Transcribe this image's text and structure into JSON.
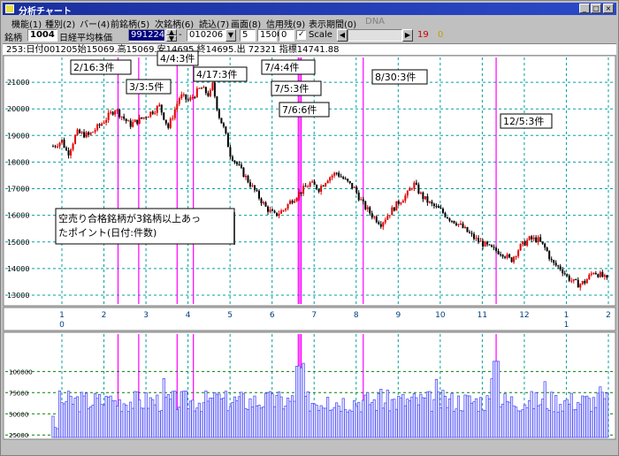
{
  "window": {
    "title": "分析チャート"
  },
  "menu": [
    "機能(1)",
    "種別(2)",
    "バー(4)",
    "前銘柄(5)",
    "次銘柄(6)",
    "読込(7)",
    "画面(8)",
    "信用残(9)",
    "表示期間(0)",
    "DNA"
  ],
  "toolbar": {
    "code_label": "銘柄",
    "code_value": "1004",
    "name_value": "日経平均株価",
    "start_date": "991224",
    "dash": "-",
    "end_date": "010206",
    "value_a": "5",
    "value_b": "1500",
    "value_c": "0",
    "scale_label": "Scale",
    "count_red": "19",
    "count_yellow": "0"
  },
  "info_line": "253:日付001205始15069.高15069.安14695.終14695.出 72321 指標14741.88",
  "chart_data": {
    "type": "line",
    "price": {
      "series_points": [
        [
          0,
          18600
        ],
        [
          6,
          18800
        ],
        [
          10,
          18300
        ],
        [
          16,
          19100
        ],
        [
          24,
          19000
        ],
        [
          32,
          19400
        ],
        [
          42,
          20000
        ],
        [
          52,
          19400
        ],
        [
          62,
          19700
        ],
        [
          72,
          20100
        ],
        [
          78,
          19300
        ],
        [
          86,
          20500
        ],
        [
          92,
          20300
        ],
        [
          100,
          20800
        ],
        [
          106,
          20500
        ],
        [
          108,
          20900
        ],
        [
          112,
          19800
        ],
        [
          116,
          19200
        ],
        [
          120,
          18300
        ],
        [
          126,
          17800
        ],
        [
          132,
          17300
        ],
        [
          138,
          16800
        ],
        [
          144,
          16300
        ],
        [
          150,
          16000
        ],
        [
          156,
          16200
        ],
        [
          162,
          16600
        ],
        [
          168,
          16900
        ],
        [
          174,
          17200
        ],
        [
          180,
          17000
        ],
        [
          186,
          17400
        ],
        [
          192,
          17600
        ],
        [
          198,
          17300
        ],
        [
          204,
          17000
        ],
        [
          210,
          16400
        ],
        [
          216,
          16000
        ],
        [
          222,
          15700
        ],
        [
          228,
          16100
        ],
        [
          234,
          16500
        ],
        [
          240,
          16800
        ],
        [
          244,
          17200
        ],
        [
          250,
          16700
        ],
        [
          256,
          16400
        ],
        [
          262,
          16200
        ],
        [
          268,
          15900
        ],
        [
          274,
          15700
        ],
        [
          280,
          15400
        ],
        [
          286,
          15100
        ],
        [
          292,
          14900
        ],
        [
          298,
          14700
        ],
        [
          304,
          14600
        ],
        [
          310,
          14300
        ],
        [
          316,
          14800
        ],
        [
          322,
          15100
        ],
        [
          328,
          15100
        ],
        [
          334,
          14700
        ],
        [
          338,
          14200
        ],
        [
          344,
          14000
        ],
        [
          348,
          13700
        ],
        [
          352,
          13500
        ],
        [
          356,
          13400
        ],
        [
          360,
          13500
        ],
        [
          366,
          13900
        ],
        [
          372,
          13700
        ],
        [
          376,
          13500
        ]
      ],
      "ylim": [
        12800,
        21800
      ],
      "yticks": [
        13000,
        14000,
        15000,
        16000,
        17000,
        18000,
        19000,
        20000,
        21000
      ]
    },
    "volume": {
      "yticks": [
        25000,
        50000,
        75000,
        100000
      ],
      "ylim": [
        20000,
        140000
      ]
    },
    "x_month_ticks": [
      "1",
      "2",
      "3",
      "4",
      "5",
      "6",
      "7",
      "8",
      "9",
      "10",
      "11",
      "12",
      "1",
      "2"
    ],
    "x_year_ticks": [
      "0",
      "1"
    ],
    "marker_lines": [
      {
        "label": "2/16:3件",
        "x": 44
      },
      {
        "label": "3/3:5件",
        "x": 58
      },
      {
        "label": "4/4:3件",
        "x": 84
      },
      {
        "label": "4/17:3件",
        "x": 95
      },
      {
        "label": "7/4:4件",
        "x": 166
      },
      {
        "label": "7/5:3件",
        "x": 167
      },
      {
        "label": "7/6:6件",
        "x": 168
      },
      {
        "label": "8/30:3件",
        "x": 210
      },
      {
        "label": "12/5:3件",
        "x": 300
      }
    ],
    "annotation_lines": [
      "空売り合格銘柄が3銘柄以上あっ",
      "たポイント(日付:件数)"
    ]
  },
  "colors": {
    "up": "#e00000",
    "down": "#000000",
    "marker": "#ff00ff",
    "grid": "#00a0a0",
    "volume": "#4040ff"
  }
}
